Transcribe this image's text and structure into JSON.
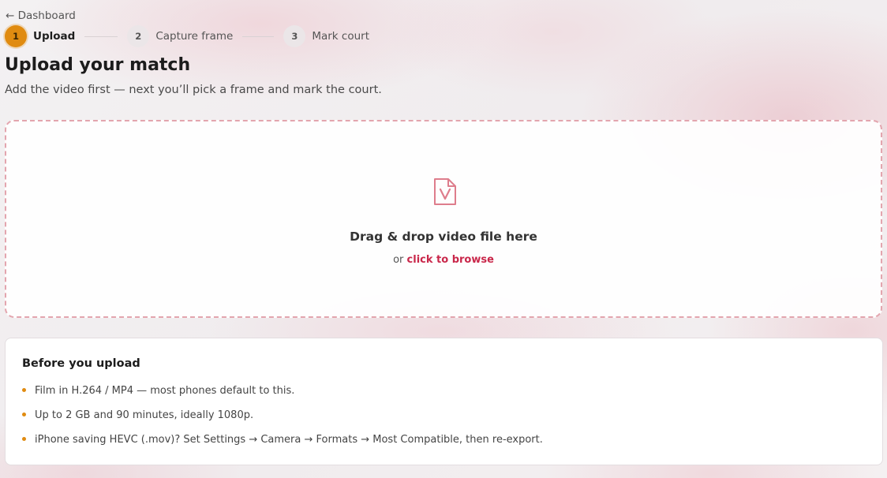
{
  "nav": {
    "back_label": "← Dashboard"
  },
  "stepper": {
    "steps": [
      {
        "num": "1",
        "label": "Upload",
        "active": true
      },
      {
        "num": "2",
        "label": "Capture frame",
        "active": false
      },
      {
        "num": "3",
        "label": "Mark court",
        "active": false
      }
    ]
  },
  "page": {
    "title": "Upload your match",
    "subtitle": "Add the video first — next you’ll pick a frame and mark the court."
  },
  "dropzone": {
    "icon": "video-file-icon",
    "title": "Drag & drop video file here",
    "or_text": "or",
    "browse_label": "click to browse"
  },
  "info": {
    "title": "Before you upload",
    "items": [
      "Film in H.264 / MP4 — most phones default to this.",
      "Up to 2 GB and 90 minutes, ideally 1080p.",
      "iPhone saving HEVC (.mov)? Set Settings → Camera → Formats → Most Compatible, then re-export."
    ]
  },
  "colors": {
    "accent_orange": "#e08b10",
    "link_red": "#c9274a",
    "dashed_border": "#e3a5ae",
    "icon_pink": "#de7d8c"
  }
}
